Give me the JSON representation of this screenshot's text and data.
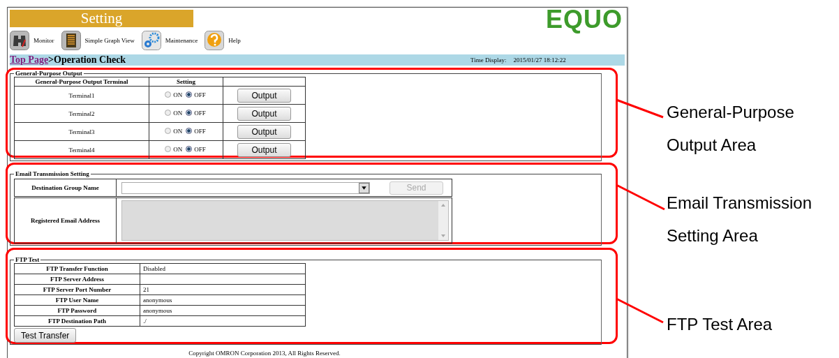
{
  "window": {
    "title": "Setting"
  },
  "logo": "EQUO",
  "nav": [
    {
      "kind": "monitor",
      "label": "Monitor"
    },
    {
      "kind": "graph",
      "label": "Simple Graph View"
    },
    {
      "kind": "maintenance",
      "label": "Maintenance"
    },
    {
      "kind": "help",
      "label": "Help"
    }
  ],
  "breadcrumb": {
    "link": "Top Page",
    "current": ">Operation Check"
  },
  "time": {
    "label": "Time Display:",
    "value": "2015/01/27 18:12:22"
  },
  "gp_output": {
    "legend": "General-Purpose Output",
    "columns": [
      "General-Purpose Output Terminal",
      "Setting"
    ],
    "rows": [
      {
        "terminal": "Terminal1",
        "options": [
          {
            "label": "ON",
            "selected": false
          },
          {
            "label": "OFF",
            "selected": true
          }
        ],
        "button": "Output"
      },
      {
        "terminal": "Terminal2",
        "options": [
          {
            "label": "ON",
            "selected": false
          },
          {
            "label": "OFF",
            "selected": true
          }
        ],
        "button": "Output"
      },
      {
        "terminal": "Terminal3",
        "options": [
          {
            "label": "ON",
            "selected": false
          },
          {
            "label": "OFF",
            "selected": true
          }
        ],
        "button": "Output"
      },
      {
        "terminal": "Terminal4",
        "options": [
          {
            "label": "ON",
            "selected": false
          },
          {
            "label": "OFF",
            "selected": true
          }
        ],
        "button": "Output"
      }
    ]
  },
  "email": {
    "legend": "Email Transmission Setting",
    "group_label": "Destination Group Name",
    "send_button": {
      "label": "Send",
      "disabled": true
    },
    "address_label": "Registered Email Address"
  },
  "ftp": {
    "legend": "FTP Test",
    "rows": [
      {
        "label": "FTP Transfer Function",
        "value": "Disabled"
      },
      {
        "label": "FTP Server Address"
      },
      {
        "label": "FTP Server Port Number",
        "value": "21"
      },
      {
        "label": "FTP User Name",
        "value": "anonymous"
      },
      {
        "label": "FTP Password",
        "value": "anonymous"
      },
      {
        "label": "FTP Destination Path",
        "value": "./"
      }
    ],
    "button": "Test Transfer"
  },
  "copyright": "Copyright OMRON Corporation 2013, All Rights Reserved.",
  "callouts": [
    {
      "text": "General-Purpose Output Area"
    },
    {
      "text": "Email Transmission Setting Area"
    },
    {
      "text": "FTP Test Area"
    }
  ]
}
